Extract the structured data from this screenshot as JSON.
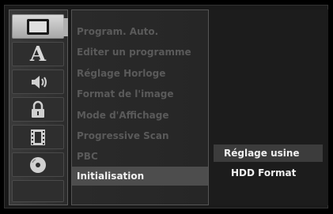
{
  "sidebar": {
    "icons": [
      {
        "name": "tv-screen-icon",
        "active": true
      },
      {
        "name": "language-letter-icon",
        "label": "A"
      },
      {
        "name": "speaker-audio-icon"
      },
      {
        "name": "padlock-icon"
      },
      {
        "name": "film-strip-icon"
      },
      {
        "name": "disc-icon"
      }
    ]
  },
  "menu": {
    "items": [
      "Program. Auto.",
      "Editer un programme",
      "Réglage Horloge",
      "Format de l'image",
      "Mode d'Affichage",
      "Progressive Scan",
      "PBC",
      "Initialisation"
    ],
    "active_index": 7
  },
  "submenu": {
    "items": [
      "Réglage usine",
      "HDD Format"
    ],
    "selected_index": 0
  }
}
